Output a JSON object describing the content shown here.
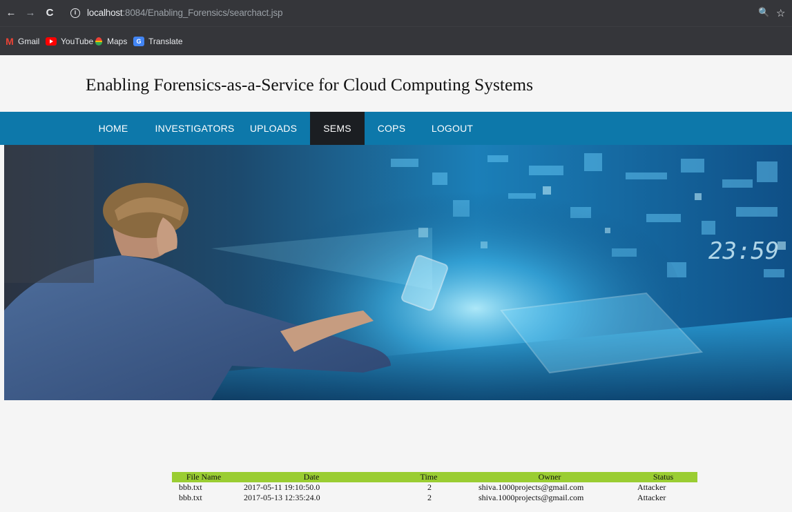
{
  "browser": {
    "back": "←",
    "forward": "→",
    "reload": "C",
    "info_icon": "i",
    "url_host": "localhost",
    "url_path": ":8084/Enabling_Forensics/searchact.jsp",
    "zoom_icon": "🔍",
    "star_icon": "☆"
  },
  "bookmarks": [
    {
      "label": "Gmail",
      "icon": "gmail-icon"
    },
    {
      "label": "YouTube",
      "icon": "youtube-icon"
    },
    {
      "label": "Maps",
      "icon": "maps-icon"
    },
    {
      "label": "Translate",
      "icon": "translate-icon"
    }
  ],
  "site": {
    "title": "Enabling Forensics-as-a-Service for Cloud Computing Systems"
  },
  "menu": {
    "items": [
      "HOME",
      "INVESTIGATORS",
      "UPLOADS",
      "SEMS",
      "COPS",
      "LOGOUT"
    ],
    "active": "SEMS"
  },
  "hero": {
    "clock_text": "23:59"
  },
  "table": {
    "headers": [
      "File Name",
      "Date",
      "Time",
      "Owner",
      "Status"
    ],
    "rows": [
      [
        "bbb.txt",
        "2017-05-11 19:10:50.0",
        "2",
        "shiva.1000projects@gmail.com",
        "Attacker"
      ],
      [
        "bbb.txt",
        "2017-05-13 12:35:24.0",
        "2",
        "shiva.1000projects@gmail.com",
        "Attacker"
      ]
    ]
  },
  "colors": {
    "chrome": "#35363a",
    "menu_bar": "#0d78aa",
    "menu_active": "#1b1e22",
    "table_header": "#9acd32"
  }
}
